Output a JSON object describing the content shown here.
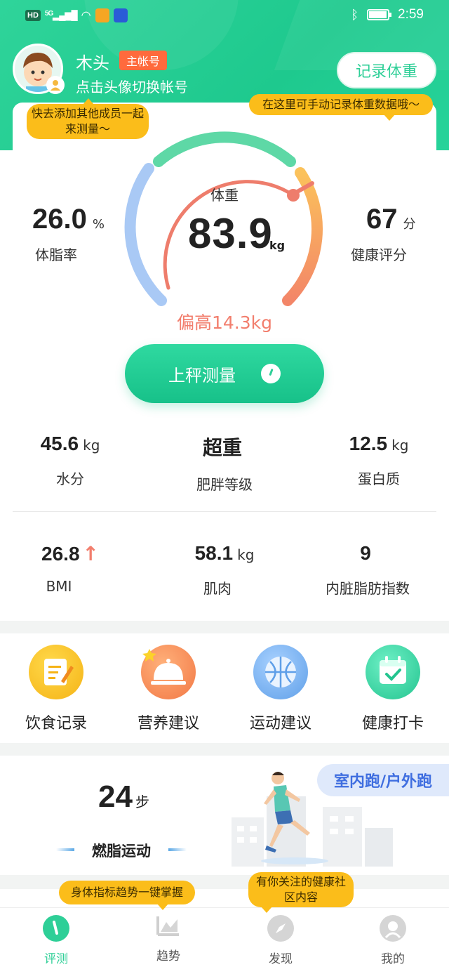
{
  "status_bar": {
    "hd": "HD",
    "network": "5G",
    "time": "2:59",
    "battery_level": 0.9
  },
  "profile": {
    "name": "木头",
    "badge": "主帐号",
    "hint": "点击头像切换帐号",
    "record_button": "记录体重",
    "tip_add_member": "快去添加其他成员一起来测量～",
    "tip_record": "在这里可手动记录体重数据哦～"
  },
  "weight": {
    "label": "体重",
    "value": "83.9",
    "unit": "kg",
    "over": "偏高14.3kg"
  },
  "body_fat": {
    "value": "26.0",
    "unit": "%",
    "label": "体脂率"
  },
  "health_score": {
    "value": "67",
    "unit": "分",
    "label": "健康评分"
  },
  "measure_button": "上秤测量",
  "metrics_row1": [
    {
      "value": "45.6",
      "unit": "kg",
      "label": "水分"
    },
    {
      "value": "超重",
      "unit": "",
      "label": "肥胖等级"
    },
    {
      "value": "12.5",
      "unit": "kg",
      "label": "蛋白质"
    }
  ],
  "metrics_row2": [
    {
      "value": "26.8",
      "unit": "",
      "label": "BMI"
    },
    {
      "value": "58.1",
      "unit": "kg",
      "label": "肌肉"
    },
    {
      "value": "9",
      "unit": "",
      "label": "内脏脂肪指数"
    }
  ],
  "actions": [
    {
      "label": "饮食记录",
      "icon": "notepad-icon",
      "color": "#f7c21e"
    },
    {
      "label": "营养建议",
      "icon": "dish-cloche-icon",
      "color": "#f59a56"
    },
    {
      "label": "运动建议",
      "icon": "basketball-icon",
      "color": "#79b3ef"
    },
    {
      "label": "健康打卡",
      "icon": "calendar-check-icon",
      "color": "#36d1a6"
    }
  ],
  "run": {
    "steps": "24",
    "steps_unit": "步",
    "burn_label": "燃脂运动",
    "tag": "室内跑/户外跑"
  },
  "tips": {
    "trend": "身体指标趋势一键掌握",
    "community": "有你关注的健康社区内容"
  },
  "tabs": [
    {
      "label": "评测",
      "active": true
    },
    {
      "label": "趋势",
      "active": false
    },
    {
      "label": "发现",
      "active": false
    },
    {
      "label": "我的",
      "active": false
    }
  ],
  "colors": {
    "accent": "#2ecf97",
    "tip": "#fbbd1a",
    "over_text": "#f27e6d"
  }
}
